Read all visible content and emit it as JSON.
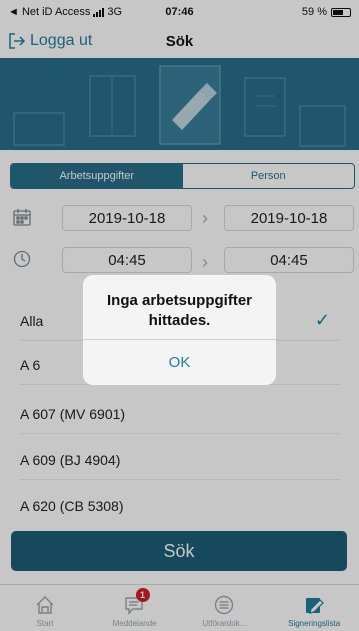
{
  "status_bar": {
    "carrier": "◄ Net iD Access",
    "network": "3G",
    "time": "07:46",
    "battery": "59 %"
  },
  "nav": {
    "logout_label": "Logga ut",
    "title": "Sök"
  },
  "tabs": {
    "left": "Arbetsuppgifter",
    "right": "Person",
    "selected": "Arbetsuppgifter"
  },
  "date_range": {
    "from": "2019-10-18",
    "to": "2019-10-18"
  },
  "time_range": {
    "from": "04:45",
    "to": "04:45"
  },
  "list": {
    "items": [
      {
        "label": "Alla",
        "checked": true
      },
      {
        "label": "A 6",
        "checked": false
      },
      {
        "label": "A 607 (MV 6901)",
        "checked": false
      },
      {
        "label": "A 609 (BJ 4904)",
        "checked": false
      },
      {
        "label": "A 620 (CB 5308)",
        "checked": false
      }
    ]
  },
  "search_button": "Sök",
  "tabbar": {
    "items": [
      {
        "label": "Start",
        "icon": "home-icon"
      },
      {
        "label": "Meddelande",
        "icon": "message-icon",
        "badge": "1"
      },
      {
        "label": "Utförardok...",
        "icon": "list-icon"
      },
      {
        "label": "Signeringslista",
        "icon": "sign-icon",
        "active": true
      }
    ]
  },
  "alert": {
    "message": "Inga arbetsuppgifter hittades.",
    "ok_label": "OK"
  },
  "colors": {
    "accent": "#1f7ea1",
    "primary_dark": "#1d5e78",
    "banner": "#2a6f8b",
    "badge": "#d0202a"
  }
}
